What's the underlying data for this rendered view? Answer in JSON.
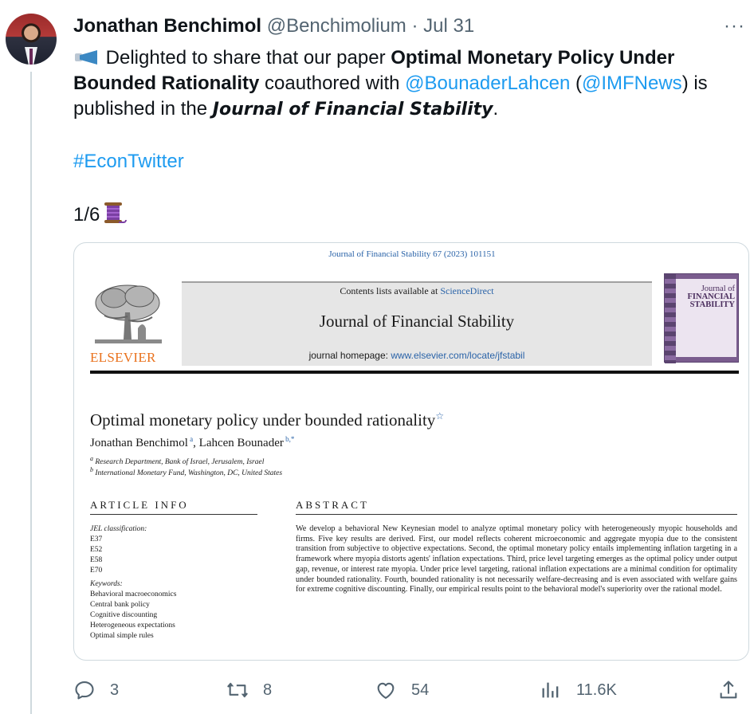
{
  "tweet": {
    "author_name": "Jonathan Benchimol",
    "handle": "@Benchimolium",
    "separator": "·",
    "date": "Jul 31",
    "more": "···",
    "text": {
      "intro": " Delighted to share that our paper ",
      "paper_title": "Optimal Monetary Policy Under Bounded Rationality",
      "coauthored": " coauthored with ",
      "mention1": "@BounaderLahcen",
      "paren_open": " (",
      "mention2": "@IMFNews",
      "paren_close": ") is published in the ",
      "journal": "Journal of Financial Stability",
      "period": "."
    },
    "hashtag": "#EconTwitter",
    "thread_count": "1/6",
    "icons": {
      "megaphone": "megaphone-icon",
      "thread": "spool-icon"
    }
  },
  "paper": {
    "citation": "Journal of Financial Stability 67 (2023) 101151",
    "publisher_wordmark": "ELSEVIER",
    "contents_prefix": "Contents lists available at ",
    "contents_link": "ScienceDirect",
    "journal_name": "Journal of Financial Stability",
    "homepage_prefix": "journal homepage: ",
    "homepage_url": "www.elsevier.com/locate/jfstabil",
    "cover": {
      "line1": "Journal of",
      "line2": "FINANCIAL",
      "line3": "STABILITY"
    },
    "title": "Optimal monetary policy under bounded rationality",
    "title_mark": "☆",
    "authors": [
      {
        "name": "Jonathan Benchimol",
        "sup": "a"
      },
      {
        "name": "Lahcen Bounader",
        "sup": "b,*"
      }
    ],
    "author_sep": ", ",
    "affiliations": [
      {
        "mark": "a",
        "text": " Research Department, Bank of Israel, Jerusalem, Israel"
      },
      {
        "mark": "b",
        "text": " International Monetary Fund, Washington, DC, United States"
      }
    ],
    "article_info_heading": "ARTICLE INFO",
    "abstract_heading": "ABSTRACT",
    "jel_label": "JEL classification:",
    "jel_codes": [
      "E37",
      "E52",
      "E58",
      "E70"
    ],
    "keywords_label": "Keywords:",
    "keywords": [
      "Behavioral macroeconomics",
      "Central bank policy",
      "Cognitive discounting",
      "Heterogeneous expectations",
      "Optimal simple rules"
    ],
    "abstract": "We develop a behavioral New Keynesian model to analyze optimal monetary policy with heterogeneously myopic households and firms. Five key results are derived. First, our model reflects coherent microeconomic and aggregate myopia due to the consistent transition from subjective to objective expectations. Second, the optimal monetary policy entails implementing inflation targeting in a framework where myopia distorts agents' inflation expectations. Third, price level targeting emerges as the optimal policy under output gap, revenue, or interest rate myopia. Under price level targeting, rational inflation expectations are a minimal condition for optimality under bounded rationality. Fourth, bounded rationality is not necessarily welfare-decreasing and is even associated with welfare gains for extreme cognitive discounting. Finally, our empirical results point to the behavioral model's superiority over the rational model."
  },
  "actions": {
    "reply_count": "3",
    "retweet_count": "8",
    "like_count": "54",
    "views_count": "11.6K"
  },
  "colors": {
    "link": "#1d9bf0",
    "muted": "#536471",
    "text": "#0f1419",
    "elsevier_orange": "#e9711c"
  }
}
